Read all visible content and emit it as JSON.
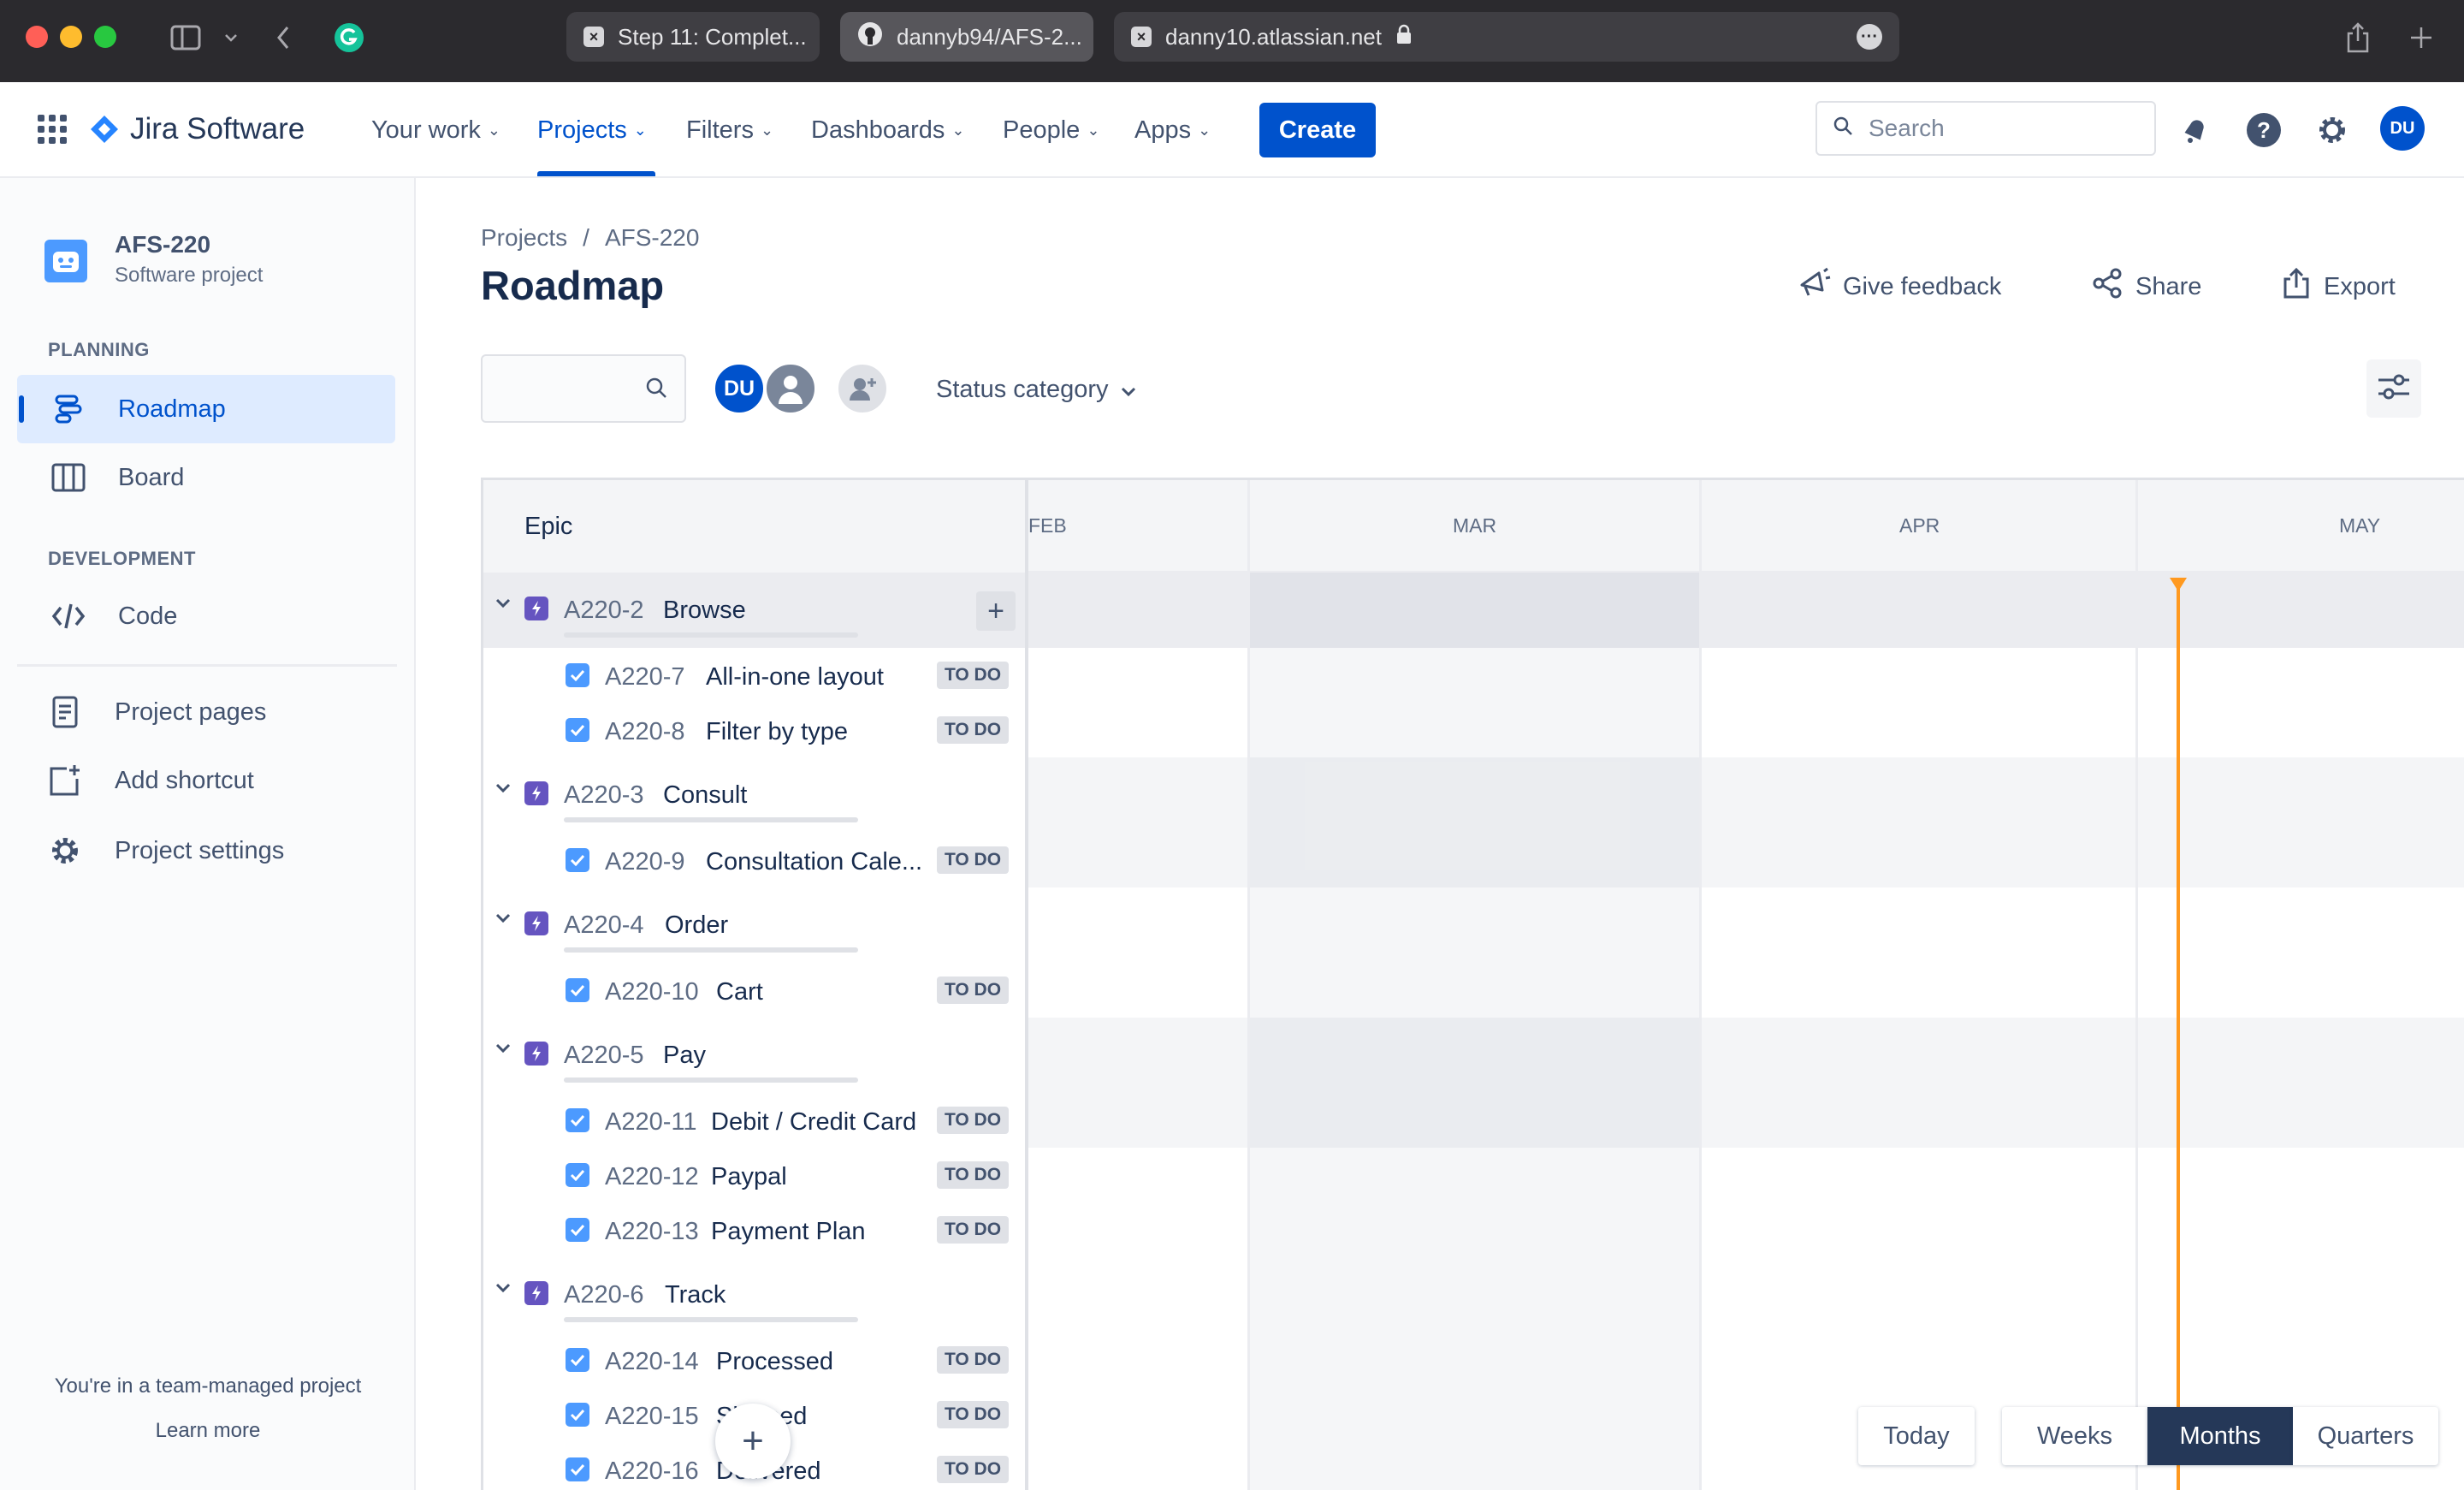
{
  "browser": {
    "tabs": [
      {
        "label": "Step 11: Complet...",
        "icon": "close-icon"
      },
      {
        "label": "dannyb94/AFS-2...",
        "icon": "github-icon"
      },
      {
        "label": "danny10.atlassian.net",
        "icon": "close-icon"
      }
    ]
  },
  "topnav": {
    "product": "Jira Software",
    "items": [
      {
        "label": "Your work"
      },
      {
        "label": "Projects"
      },
      {
        "label": "Filters"
      },
      {
        "label": "Dashboards"
      },
      {
        "label": "People"
      },
      {
        "label": "Apps"
      }
    ],
    "active_item": "Projects",
    "create_label": "Create",
    "search_placeholder": "Search",
    "avatar_initials": "DU"
  },
  "sidebar": {
    "project_name": "AFS-220",
    "project_type": "Software project",
    "planning_heading": "PLANNING",
    "development_heading": "DEVELOPMENT",
    "items": [
      {
        "label": "Roadmap",
        "icon": "roadmap-icon"
      },
      {
        "label": "Board",
        "icon": "board-icon"
      },
      {
        "label": "Code",
        "icon": "code-icon"
      },
      {
        "label": "Project pages",
        "icon": "pages-icon"
      },
      {
        "label": "Add shortcut",
        "icon": "add-shortcut-icon"
      },
      {
        "label": "Project settings",
        "icon": "gear-icon"
      }
    ],
    "active_item": "Roadmap",
    "footer_text": "You're in a team-managed project",
    "footer_link": "Learn more"
  },
  "main": {
    "breadcrumbs": [
      "Projects",
      "/",
      "AFS-220"
    ],
    "title": "Roadmap",
    "actions": {
      "feedback": "Give feedback",
      "share": "Share",
      "export": "Export"
    },
    "filter_avatar_initials": "DU",
    "status_filter": "Status category"
  },
  "roadmap": {
    "epic_header": "Epic",
    "months": [
      "FEB",
      "MAR",
      "APR",
      "MAY"
    ],
    "epics": [
      {
        "key": "A220-2",
        "title": "Browse",
        "children": [
          {
            "key": "A220-7",
            "title": "All-in-one layout",
            "status": "TO DO"
          },
          {
            "key": "A220-8",
            "title": "Filter by type",
            "status": "TO DO"
          }
        ]
      },
      {
        "key": "A220-3",
        "title": "Consult",
        "children": [
          {
            "key": "A220-9",
            "title": "Consultation Cale...",
            "status": "TO DO"
          }
        ]
      },
      {
        "key": "A220-4",
        "title": "Order",
        "children": [
          {
            "key": "A220-10",
            "title": "Cart",
            "status": "TO DO"
          }
        ]
      },
      {
        "key": "A220-5",
        "title": "Pay",
        "children": [
          {
            "key": "A220-11",
            "title": "Debit / Credit Card",
            "status": "TO DO"
          },
          {
            "key": "A220-12",
            "title": "Paypal",
            "status": "TO DO"
          },
          {
            "key": "A220-13",
            "title": "Payment Plan",
            "status": "TO DO"
          }
        ]
      },
      {
        "key": "A220-6",
        "title": "Track",
        "children": [
          {
            "key": "A220-14",
            "title": "Processed",
            "status": "TO DO"
          },
          {
            "key": "A220-15",
            "title": "Shipped",
            "status": "TO DO"
          },
          {
            "key": "A220-16",
            "title": "Delivered",
            "status": "TO DO"
          }
        ]
      }
    ],
    "view_controls": {
      "today": "Today",
      "weeks": "Weeks",
      "months": "Months",
      "quarters": "Quarters",
      "selected": "Months"
    }
  },
  "colors": {
    "accent": "#0052cc",
    "epic": "#6554c0",
    "today_marker": "#ff991f",
    "chrome": "#2b2a2e"
  }
}
